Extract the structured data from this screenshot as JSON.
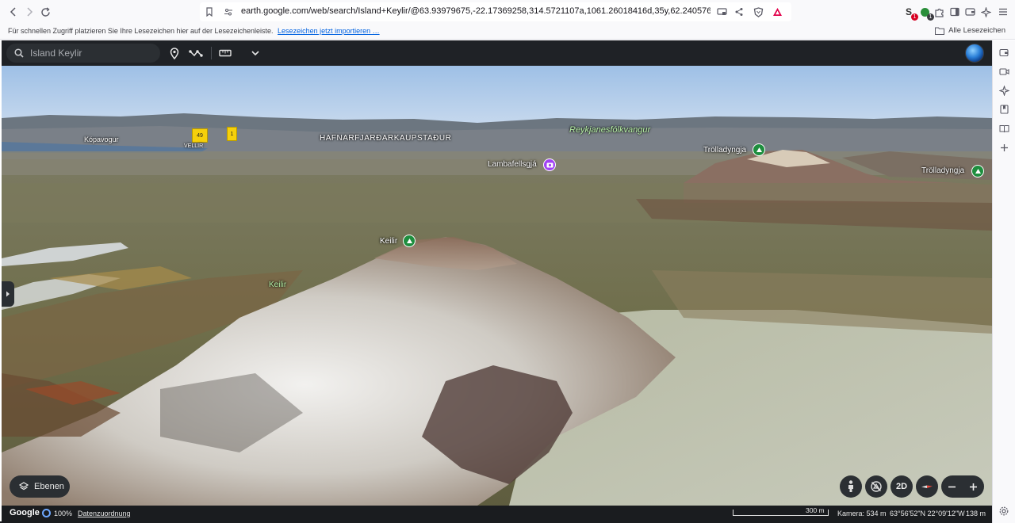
{
  "browser": {
    "url": "earth.google.com/web/search/Island+Keylir/@63.93979675,-22.17369258,314.5721107a,1061.26018416d,35y,62.24057691h,78.08592486...",
    "bookmarks_hint": "Für schnellen Zugriff platzieren Sie Ihre Lesezeichen hier auf der Lesezeichenleiste.",
    "bookmarks_import": "Lesezeichen jetzt importieren …",
    "all_bookmarks": "Alle Lesezeichen",
    "extension_badges": {
      "first": "1",
      "second": "1"
    },
    "colors": {
      "badge_red": "#d70022",
      "badge_green": "#2a8e3a"
    }
  },
  "earth": {
    "search": {
      "value": "",
      "placeholder": "Island Keylir"
    },
    "layers_label": "Ebenen",
    "view_mode_label": "2D",
    "status": {
      "logo": "Google",
      "load_percent": "100%",
      "attribution": "Datenzuordnung",
      "scale": "300 m",
      "camera": "Kamera: 534 m",
      "coordinates": "63°56'52\"N 22°09'12\"W",
      "altitude": "138 m"
    },
    "map_labels": {
      "kopavogur": "Kópavogur",
      "vellir": "VELLIR",
      "hafnarfjardar": "HAFNARFJARÐARKAUPSTAÐUR",
      "reykjanes": "Reykjanesfólkvangur",
      "keilir_area": "Keilir"
    },
    "road_shields": {
      "r49": "49",
      "r1": "1"
    },
    "pois": {
      "lambafellsgja": "Lambafellsgjá",
      "trolladyngja_1": "Trölladyngja",
      "trolladyngja_2": "Trölladyngja",
      "keilir_peak": "Keilir"
    },
    "colors": {
      "poi_green": "#1e8e3e",
      "poi_purple": "#a142f4",
      "header_bg": "#1f2226"
    }
  }
}
